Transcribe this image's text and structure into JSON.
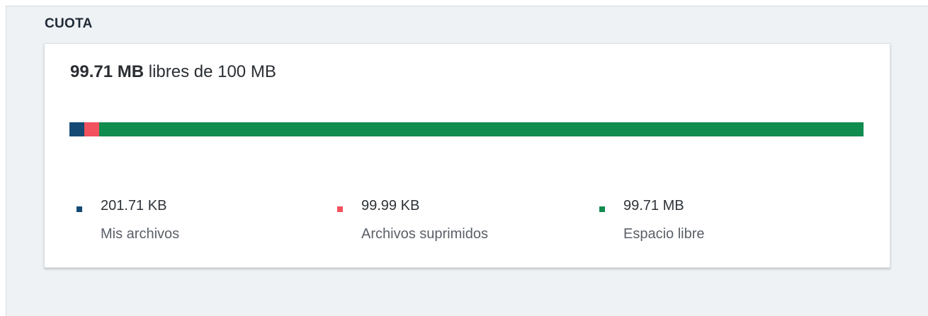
{
  "quota": {
    "title": "CUOTA",
    "free_amount": "99.71 MB",
    "free_suffix": " libres de 100 MB",
    "usage": [
      {
        "key": "mine",
        "value": "201.71 KB",
        "label": "Mis archivos",
        "fraction": 0.00197,
        "color": "#144a74"
      },
      {
        "key": "deleted",
        "value": "99.99 KB",
        "label": "Archivos suprimidos",
        "fraction": 0.000976,
        "color": "#f2515e"
      },
      {
        "key": "free",
        "value": "99.71 MB",
        "label": "Espacio libre",
        "fraction": 0.99705,
        "color": "#118c4f"
      }
    ]
  }
}
